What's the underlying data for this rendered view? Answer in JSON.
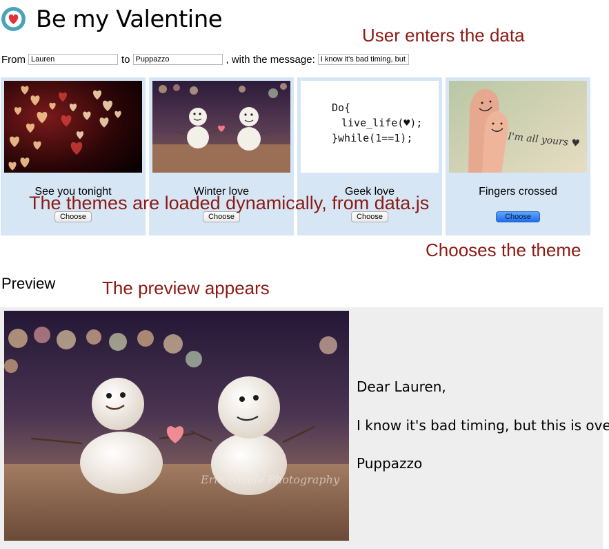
{
  "header": {
    "title": "Be my Valentine",
    "logo_icon": "heart-icon"
  },
  "annotations": {
    "user_enters": "User enters the data",
    "themes_loaded": "The themes are loaded dynamically, from data.js",
    "chooses_theme": "Chooses the theme",
    "preview_appears": "The preview appears"
  },
  "form": {
    "from_label": "From",
    "from_value": "Lauren",
    "to_label": "to",
    "to_value": "Puppazzo",
    "message_label": ", with the message:",
    "message_value": "I know it's bad timing, but this is over."
  },
  "themes": [
    {
      "name": "See you tonight",
      "button": "Choose",
      "selected": false,
      "image": "bokeh-hearts"
    },
    {
      "name": "Winter love",
      "button": "Choose",
      "selected": false,
      "image": "snowmen"
    },
    {
      "name": "Geek love",
      "button": "Choose",
      "selected": false,
      "image": "code-heart",
      "code_lines": [
        "Do{",
        "live_life(♥);",
        "}while(1==1);"
      ]
    },
    {
      "name": "Fingers crossed",
      "button": "Choose",
      "selected": true,
      "image": "fingers",
      "caption": "I'm all yours ♥"
    }
  ],
  "preview": {
    "heading": "Preview",
    "image": "snowmen",
    "image_watermark": "Erin Nicole Photography",
    "greeting": "Dear Lauren,",
    "message": "I know it's bad timing, but this is over.",
    "signature": "Puppazzo"
  },
  "colors": {
    "annotation": "#8b1a12",
    "theme_card_bg": "#d6e6f5",
    "preview_bg": "#eeeeee",
    "logo_bg": "#4aa3b8",
    "selected_button": "#1d6ef0"
  }
}
